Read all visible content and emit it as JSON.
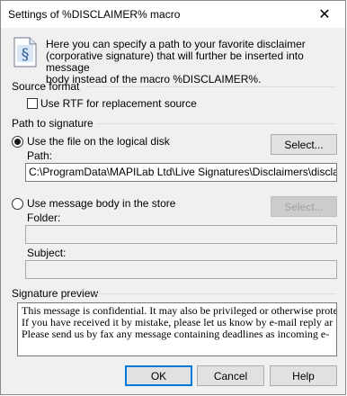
{
  "window": {
    "title": "Settings of %DISCLAIMER% macro",
    "close_glyph": "✕"
  },
  "info": {
    "icon": "document-section-icon",
    "icon_glyph": "§",
    "line1": "Here you can specify a path to your favorite disclaimer",
    "line2": "(corporative signature) that will further be inserted into message",
    "line3": "body instead of the macro %DISCLAIMER%."
  },
  "source_format": {
    "group_label": "Source format",
    "use_rtf_label": "Use RTF for replacement source",
    "use_rtf_checked": false
  },
  "path_to_signature": {
    "group_label": "Path to signature",
    "logical_disk_option": {
      "label": "Use the file on the logical disk",
      "selected": true,
      "select_button": "Select...",
      "path_label": "Path:",
      "path_value": "C:\\ProgramData\\MAPILab Ltd\\Live Signatures\\Disclaimers\\disclaimer-lin"
    },
    "store_option": {
      "label": "Use message body in the store",
      "selected": false,
      "select_button": "Select...",
      "folder_label": "Folder:",
      "folder_value": "",
      "subject_label": "Subject:",
      "subject_value": ""
    }
  },
  "signature_preview": {
    "group_label": "Signature preview",
    "lines": [
      "This message is confidential. It may also be privileged or otherwise prote",
      "If you have received it by mistake, please let us know by e-mail reply ar",
      "Please send us by fax any message containing deadlines as incoming e-"
    ]
  },
  "buttons": {
    "ok": "OK",
    "cancel": "Cancel",
    "help": "Help"
  }
}
